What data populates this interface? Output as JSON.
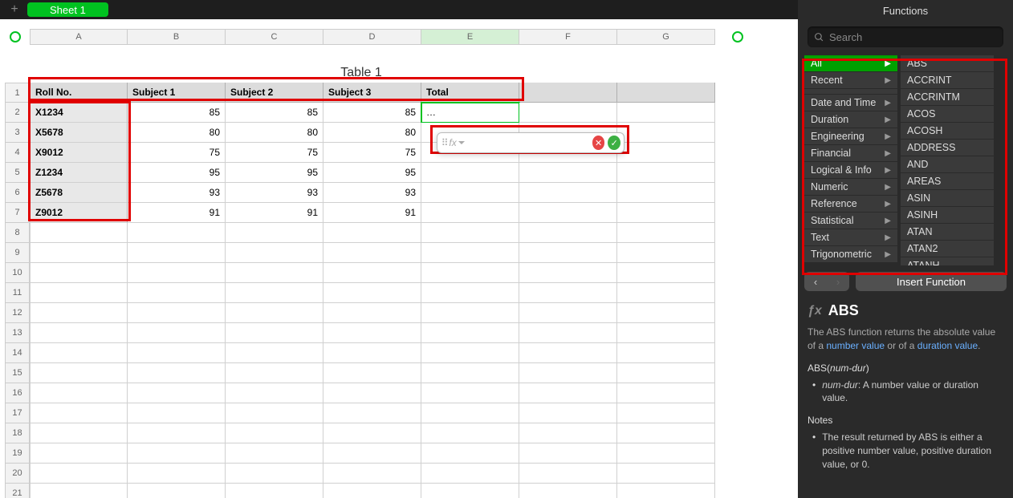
{
  "sheet_tab": "Sheet 1",
  "table_title": "Table 1",
  "columns": [
    "A",
    "B",
    "C",
    "D",
    "E",
    "F",
    "G"
  ],
  "active_column": "E",
  "row_count": 21,
  "headers": [
    "Roll No.",
    "Subject 1",
    "Subject 2",
    "Subject 3",
    "Total"
  ],
  "rows": [
    {
      "roll": "X1234",
      "s1": 85,
      "s2": 85,
      "s3": 85,
      "total": "…"
    },
    {
      "roll": "X5678",
      "s1": 80,
      "s2": 80,
      "s3": 80,
      "total": ""
    },
    {
      "roll": "X9012",
      "s1": 75,
      "s2": 75,
      "s3": 75,
      "total": ""
    },
    {
      "roll": "Z1234",
      "s1": 95,
      "s2": 95,
      "s3": 95,
      "total": ""
    },
    {
      "roll": "Z5678",
      "s1": 93,
      "s2": 93,
      "s3": 93,
      "total": ""
    },
    {
      "roll": "Z9012",
      "s1": 91,
      "s2": 91,
      "s3": 91,
      "total": ""
    }
  ],
  "formula_popup": {
    "fx_label": "fx",
    "cancel_glyph": "✕",
    "accept_glyph": "✓",
    "value": ""
  },
  "sidebar": {
    "title": "Functions",
    "search_placeholder": "Search",
    "categories": [
      "All",
      "Recent",
      "",
      "Date and Time",
      "Duration",
      "Engineering",
      "Financial",
      "Logical & Info",
      "Numeric",
      "Reference",
      "Statistical",
      "Text",
      "Trigonometric"
    ],
    "selected_category": "All",
    "functions": [
      "ABS",
      "ACCRINT",
      "ACCRINTM",
      "ACOS",
      "ACOSH",
      "ADDRESS",
      "AND",
      "AREAS",
      "ASIN",
      "ASINH",
      "ATAN",
      "ATAN2",
      "ATANH"
    ],
    "insert_label": "Insert Function",
    "detail": {
      "name": "ABS",
      "desc_pre": "The ABS function returns the absolute value of a ",
      "desc_link1": "number value",
      "desc_mid": " or of a ",
      "desc_link2": "duration value",
      "desc_post": ".",
      "signature": "ABS(num-dur)",
      "arg_name": "num-dur",
      "arg_text": ": A number value or duration value.",
      "notes_header": "Notes",
      "note1": "The result returned by ABS is either a positive number value, positive duration value, or 0."
    }
  }
}
